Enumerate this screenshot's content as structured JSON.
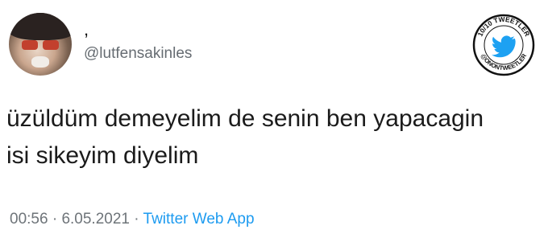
{
  "author": {
    "display_name": ",",
    "handle": "@lutfensakinles"
  },
  "tweet": {
    "lines": [
      "üzüldüm demeyelim de senin ben yapacagin",
      "isi sikeyim diyelim"
    ],
    "time": "00:56",
    "date": "6.05.2021",
    "separator": "·",
    "source": "Twitter Web App"
  },
  "badge": {
    "top_text": "10/10 TWEETLER",
    "bottom_text": "@ONONTWEETLER",
    "icon": "twitter-bird-icon"
  },
  "colors": {
    "link": "#1d9bf0",
    "muted": "#6e7479",
    "badge_bird": "#1da1f2"
  }
}
